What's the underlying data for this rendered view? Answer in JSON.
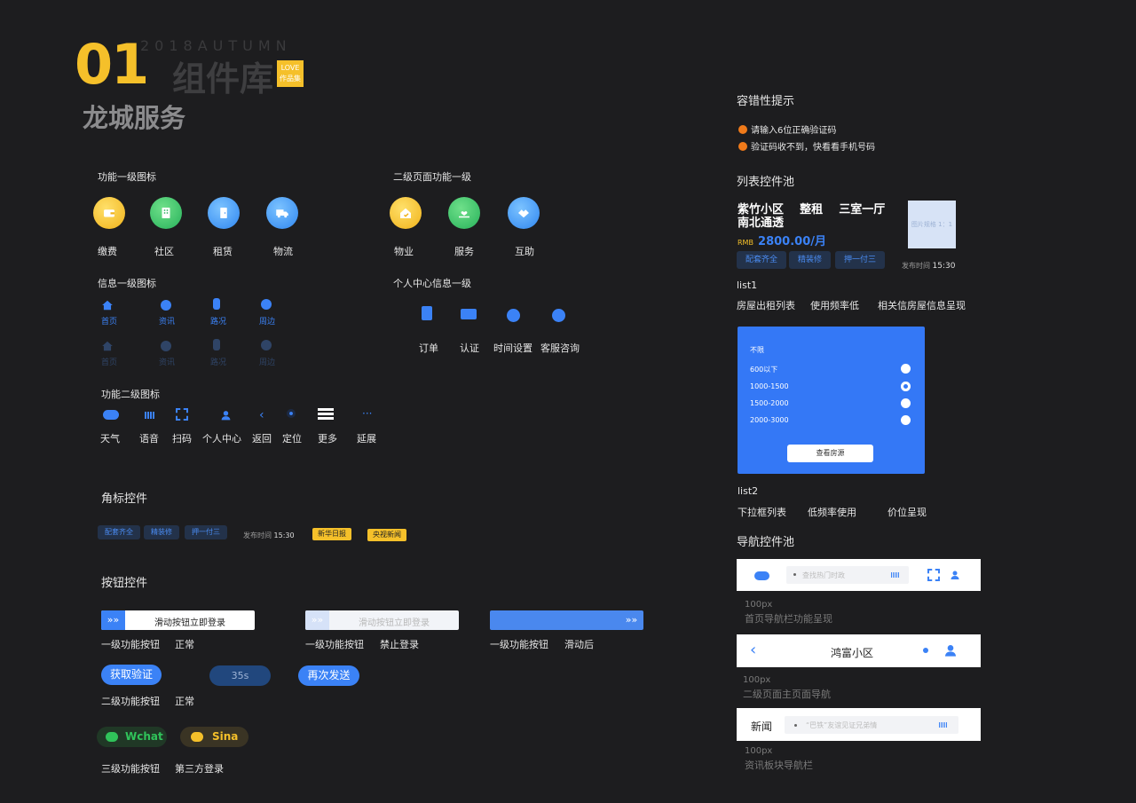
{
  "colors": {
    "accent": "#3478f6",
    "yellow": "#f5c02a",
    "bg": "#1d1d1f"
  },
  "header": {
    "number": "01",
    "year_text": "2018AUTUMN",
    "library": "组件库",
    "badge_top": "LOVE",
    "badge_bottom": "作品集",
    "project": "龙城服务"
  },
  "func_primary": {
    "title": "功能一级图标",
    "items": [
      {
        "label": "缴费",
        "icon": "wallet-icon"
      },
      {
        "label": "社区",
        "icon": "community-icon"
      },
      {
        "label": "租赁",
        "icon": "door-icon"
      },
      {
        "label": "物流",
        "icon": "truck-icon"
      }
    ]
  },
  "sub_primary": {
    "title": "二级页面功能一级",
    "items": [
      {
        "label": "物业",
        "icon": "house-icon"
      },
      {
        "label": "服务",
        "icon": "hand-heart-icon"
      },
      {
        "label": "互助",
        "icon": "handshake-icon"
      }
    ]
  },
  "info_primary": {
    "title": "信息一级图标",
    "items": [
      {
        "label": "首页",
        "icon": "home-icon"
      },
      {
        "label": "资讯",
        "icon": "news-icon"
      },
      {
        "label": "路况",
        "icon": "traffic-icon"
      },
      {
        "label": "周边",
        "icon": "location-icon"
      }
    ]
  },
  "personal": {
    "title": "个人中心信息一级",
    "items": [
      {
        "label": "订单",
        "icon": "order-icon"
      },
      {
        "label": "认证",
        "icon": "id-card-icon"
      },
      {
        "label": "时间设置",
        "icon": "clock-icon"
      },
      {
        "label": "客服咨询",
        "icon": "chat-icon"
      }
    ]
  },
  "func_secondary": {
    "title": "功能二级图标",
    "items": [
      {
        "label": "天气",
        "icon": "cloud-icon"
      },
      {
        "label": "语音",
        "icon": "voice-icon"
      },
      {
        "label": "扫码",
        "icon": "scan-icon"
      },
      {
        "label": "个人中心",
        "icon": "user-icon"
      },
      {
        "label": "返回",
        "icon": "back-icon"
      },
      {
        "label": "定位",
        "icon": "locate-icon"
      },
      {
        "label": "更多",
        "icon": "menu-icon"
      },
      {
        "label": "延展",
        "icon": "more-icon"
      }
    ]
  },
  "badges": {
    "title": "角标控件",
    "tags": [
      "配套齐全",
      "精装修",
      "押一付三"
    ],
    "time_label": "发布时间",
    "time": "15:30",
    "source_tags": [
      "新华日报",
      "央视新闻"
    ]
  },
  "buttons": {
    "title": "按钮控件",
    "slide_label": "滑动按钮立即登录",
    "row1": [
      {
        "level": "一级功能按钮",
        "state": "正常"
      },
      {
        "level": "一级功能按钮",
        "state": "禁止登录"
      },
      {
        "level": "一级功能按钮",
        "state": "滑动后"
      }
    ],
    "verify": "获取验证",
    "countdown": "35s",
    "resend": "再次发送",
    "row2": {
      "level": "二级功能按钮",
      "state": "正常"
    },
    "wechat": "Wchat",
    "weibo": "Sina",
    "row3": {
      "level": "三级功能按钮",
      "state": "第三方登录"
    }
  },
  "error_tips": {
    "title": "容错性提示",
    "items": [
      "请输入6位正确验证码",
      "验证码收不到，快看看手机号码"
    ]
  },
  "list_pool": {
    "title": "列表控件池",
    "line1": "紫竹小区    整租    三室一厅",
    "line2": "南北通透",
    "currency": "RMB",
    "price": "2800.00/月",
    "tags": [
      "配套齐全",
      "精装修",
      "押一付三"
    ],
    "image_placeholder": "图片规格 1：1",
    "time_label": "发布时间",
    "time": "15:30",
    "list1_title": "list1",
    "list1_desc": [
      "房屋出租列表",
      "使用频率低",
      "相关信房屋信息呈现"
    ]
  },
  "dropdown": {
    "header": "不限",
    "options": [
      "600以下",
      "1000-1500",
      "1500-2000",
      "2000-3000"
    ],
    "selected_index": 1,
    "button": "查看房源"
  },
  "list2": {
    "title": "list2",
    "desc": [
      "下拉框列表",
      "低频率使用",
      "价位呈现"
    ]
  },
  "nav_pool": {
    "title": "导航控件池",
    "nav1": {
      "placeholder": "查找热门时政",
      "size": "100px",
      "desc": "首页导航栏功能呈现"
    },
    "nav2": {
      "title": "鸿富小区",
      "size": "100px",
      "desc": "二级页面主页面导航"
    },
    "nav3": {
      "label": "新闻",
      "placeholder": "“巴铁”友谊见证兄弟情",
      "size": "100px",
      "desc": "资讯板块导航栏"
    }
  }
}
